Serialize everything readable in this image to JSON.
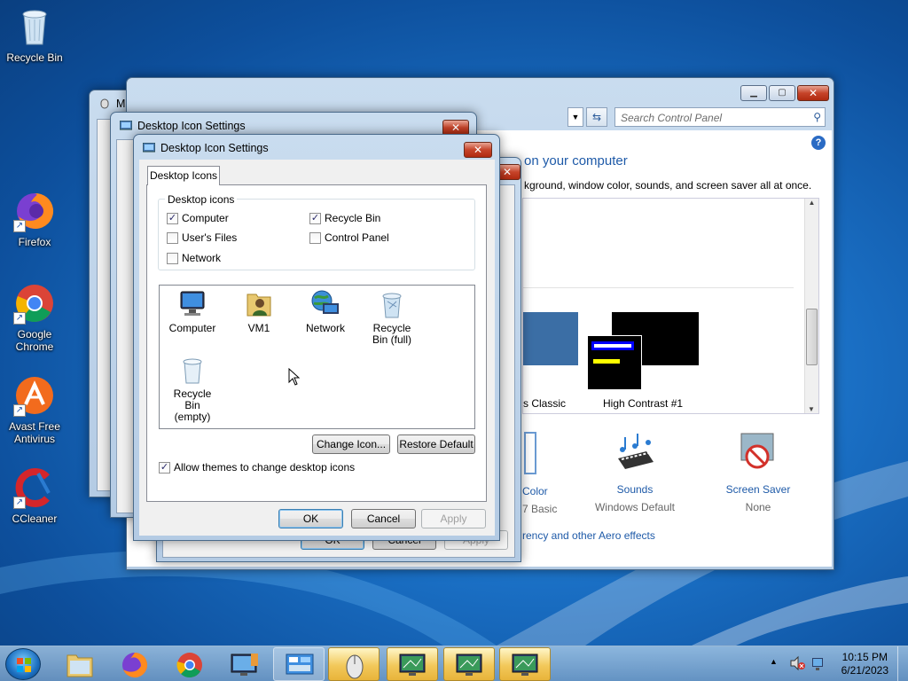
{
  "desktop": {
    "icons": [
      {
        "label": "Recycle Bin"
      },
      {
        "label": "Firefox"
      },
      {
        "label": "Google Chrome"
      },
      {
        "label": "Avast Free Antivirus"
      },
      {
        "label": "CCleaner"
      }
    ]
  },
  "control_panel": {
    "search_placeholder": "Search Control Panel",
    "heading_fragment": "on your computer",
    "desc_fragment": "kground, window color, sounds, and screen saver all at once.",
    "themes": [
      {
        "label": "s Classic"
      },
      {
        "label": "High Contrast #1"
      }
    ],
    "bottom_items": [
      {
        "label": "Color",
        "sub": "7 Basic"
      },
      {
        "label": "Sounds",
        "sub": "Windows Default"
      },
      {
        "label": "Screen Saver",
        "sub": "None"
      }
    ],
    "link_fragment": "rency and other Aero effects"
  },
  "back_window_title_fragment": "M",
  "back_dialog": {
    "title": "Desktop Icon Settings",
    "ok_fragment": "OK",
    "cancel_fragment": "Cancel",
    "apply_fragment": "Apply"
  },
  "dialog": {
    "title": "Desktop Icon Settings",
    "tab": "Desktop Icons",
    "group_label": "Desktop icons",
    "checkboxes": [
      {
        "label": "Computer",
        "checked": "✓"
      },
      {
        "label": "Recycle Bin",
        "checked": "✓"
      },
      {
        "label": "User's Files",
        "checked": ""
      },
      {
        "label": "Control Panel",
        "checked": ""
      },
      {
        "label": "Network",
        "checked": ""
      }
    ],
    "icons": [
      {
        "label": "Computer"
      },
      {
        "label": "VM1"
      },
      {
        "label": "Network"
      },
      {
        "label": "Recycle Bin (full)"
      },
      {
        "label": "Recycle Bin (empty)"
      }
    ],
    "change_icon": "Change Icon...",
    "restore_default": "Restore Default",
    "allow_themes": "Allow themes to change desktop icons",
    "allow_themes_checked": "✓",
    "ok": "OK",
    "cancel": "Cancel",
    "apply": "Apply"
  },
  "taskbar": {
    "time": "10:15 PM",
    "date": "6/21/2023"
  },
  "colors": {
    "accent_blue": "#1e5aa8",
    "window_frame": "#b4cbe4",
    "close_red": "#c6442a"
  }
}
